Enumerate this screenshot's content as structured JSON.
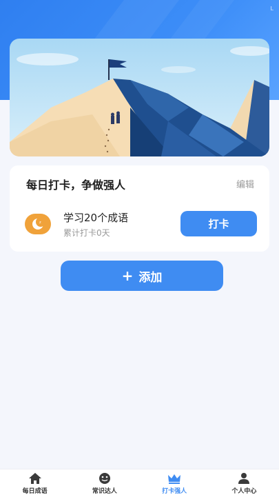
{
  "status_bar": {
    "mark": "L"
  },
  "card": {
    "title": "每日打卡，争做强人",
    "edit_label": "编辑",
    "task": {
      "name": "学习20个成语",
      "sub": "累计打卡0天",
      "button_label": "打卡"
    }
  },
  "add_button": {
    "plus": "+",
    "label": "添加"
  },
  "tabbar": {
    "items": [
      {
        "label": "每日成语",
        "icon": "home-icon"
      },
      {
        "label": "常识达人",
        "icon": "smiley-icon"
      },
      {
        "label": "打卡强人",
        "icon": "crown-icon",
        "active": true
      },
      {
        "label": "个人中心",
        "icon": "person-icon"
      }
    ]
  },
  "colors": {
    "accent": "#3f8cf2",
    "header": "#2f7ff0",
    "moon": "#f0a23a",
    "background": "#f4f6fc"
  }
}
